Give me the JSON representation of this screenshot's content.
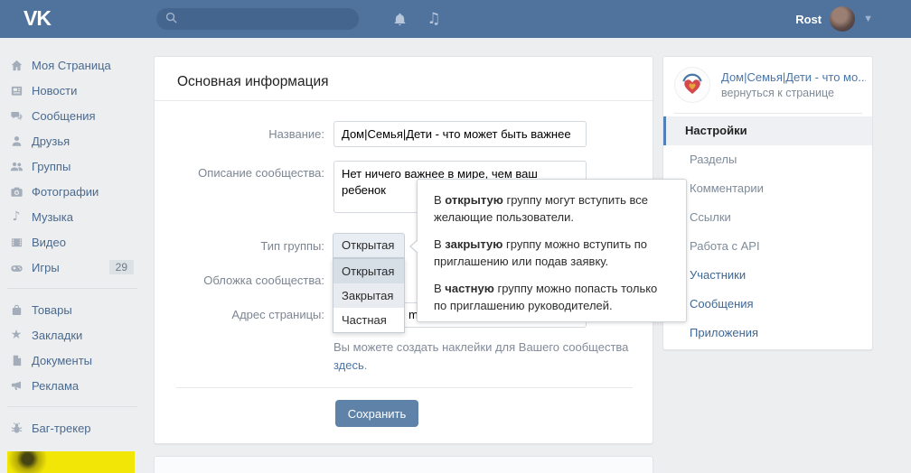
{
  "topbar": {
    "logo": "VK",
    "search_placeholder": "",
    "user_name": "Rost"
  },
  "left_menu": {
    "primary": [
      {
        "label": "Моя Страница",
        "icon": "home-icon"
      },
      {
        "label": "Новости",
        "icon": "news-icon"
      },
      {
        "label": "Сообщения",
        "icon": "messages-icon"
      },
      {
        "label": "Друзья",
        "icon": "friends-icon"
      },
      {
        "label": "Группы",
        "icon": "groups-icon"
      },
      {
        "label": "Фотографии",
        "icon": "photos-icon"
      },
      {
        "label": "Музыка",
        "icon": "music-icon"
      },
      {
        "label": "Видео",
        "icon": "video-icon"
      },
      {
        "label": "Игры",
        "icon": "games-icon",
        "badge": "29"
      }
    ],
    "secondary": [
      {
        "label": "Товары",
        "icon": "market-icon"
      },
      {
        "label": "Закладки",
        "icon": "bookmarks-icon"
      },
      {
        "label": "Документы",
        "icon": "documents-icon"
      },
      {
        "label": "Реклама",
        "icon": "ads-icon"
      }
    ],
    "tertiary": [
      {
        "label": "Баг-трекер",
        "icon": "bug-icon"
      }
    ]
  },
  "main": {
    "title": "Основная информация",
    "fields": {
      "name_label": "Название:",
      "name_value": "Дом|Семья|Дети - что может быть важнее",
      "description_label": "Описание сообщества:",
      "description_value": "Нет ничего важнее в мире, чем ваш ребенок",
      "type_label": "Тип группы:",
      "type_value": "Открытая",
      "type_options": [
        "Открытая",
        "Закрытая",
        "Частная"
      ],
      "cover_label": "Обложка сообщества:",
      "address_label": "Адрес страницы:",
      "address_visible_text": "m"
    },
    "note_text": "Вы можете создать наклейки для Вашего сообщества",
    "note_link": "здесь",
    "note_period": ".",
    "save_label": "Сохранить"
  },
  "tooltip": {
    "paragraphs": [
      {
        "pre": "В ",
        "bold": "открытую",
        "post": " группу могут вступить все желающие пользователи."
      },
      {
        "pre": "В ",
        "bold": "закрытую",
        "post": " группу можно вступить по приглашению или подав заявку."
      },
      {
        "pre": "В ",
        "bold": "частную",
        "post": " группу можно попасть только по приглашению руководителей."
      }
    ]
  },
  "right_panel": {
    "group_title": "Дом|Семья|Дети - что мо...",
    "back_link": "вернуться к странице",
    "menu": [
      {
        "label": "Настройки",
        "active": true
      },
      {
        "label": "Разделы"
      },
      {
        "label": "Комментарии"
      },
      {
        "label": "Ссылки"
      },
      {
        "label": "Работа с API"
      },
      {
        "label": "Участники",
        "blue": true
      },
      {
        "label": "Сообщения",
        "blue": true
      },
      {
        "label": "Приложения",
        "blue": true
      }
    ]
  },
  "colors": {
    "topbar": "#50739e",
    "accent_blue": "#4a76a8",
    "save_button": "#5e82a8",
    "active_accent": "#5181b8",
    "ad_yellow": "#f2e607",
    "page_bg": "#edeef0"
  }
}
